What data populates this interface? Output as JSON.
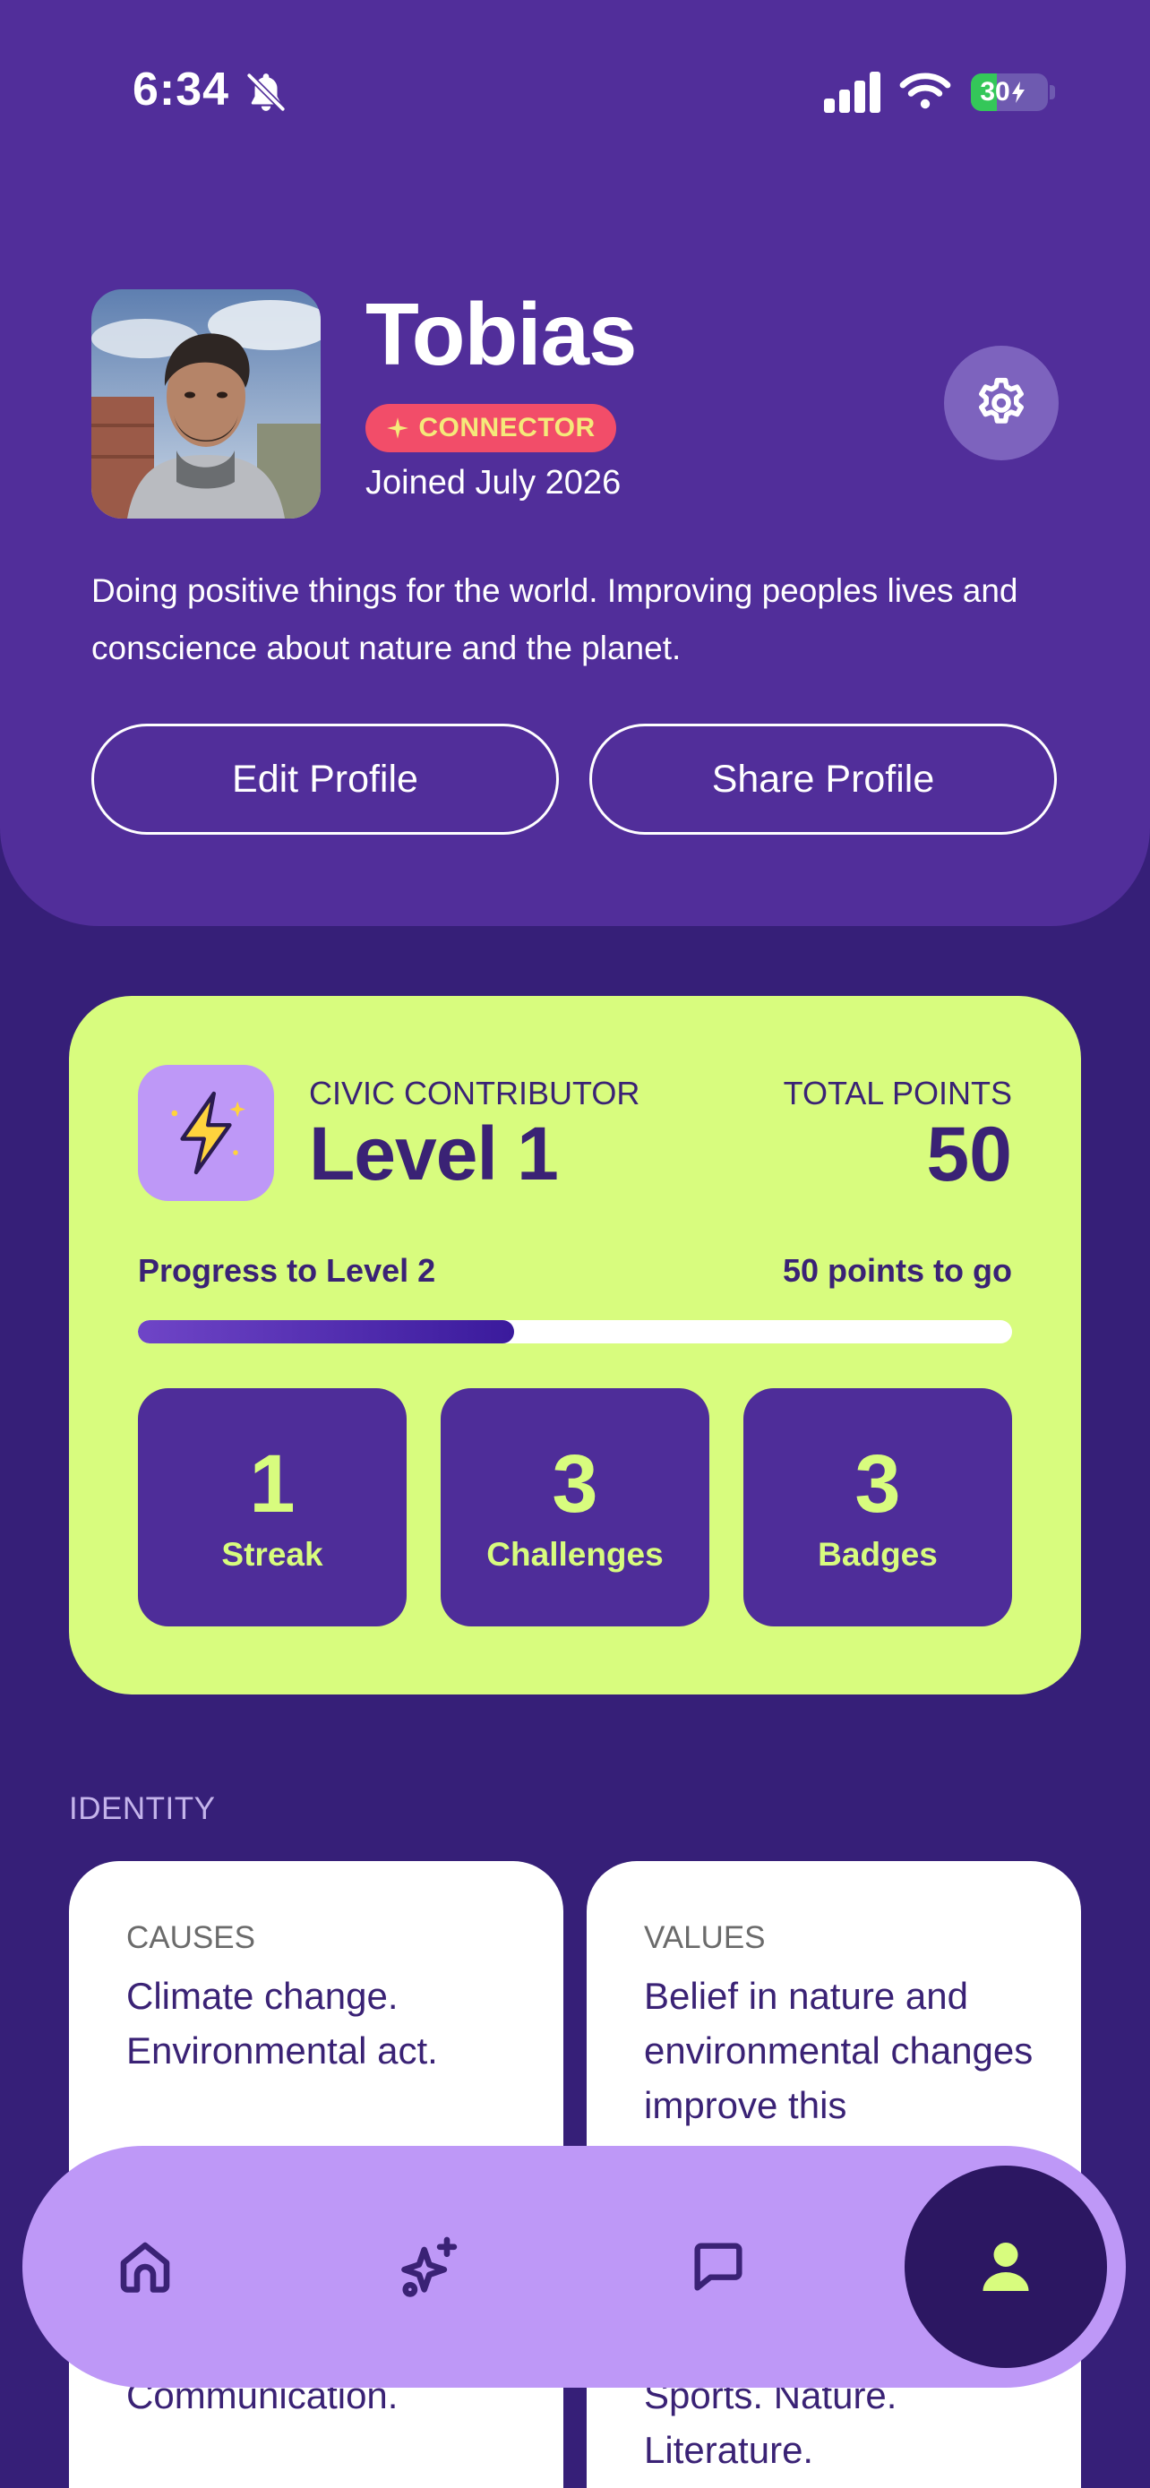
{
  "status_bar": {
    "time": "6:34",
    "battery_percent": "30"
  },
  "profile": {
    "name": "Tobias",
    "badge_label": "CONNECTOR",
    "joined": "Joined July 2026",
    "bio": "Doing positive things for the world. Improving peoples lives and conscience about nature and the planet.",
    "edit_label": "Edit Profile",
    "share_label": "Share Profile"
  },
  "level_card": {
    "rank_label": "CIVIC CONTRIBUTOR",
    "level_title": "Level 1",
    "points_label": "TOTAL POINTS",
    "points_value": "50",
    "progress_label": "Progress to Level 2",
    "progress_remaining": "50 points to go",
    "progress_fraction": 0.43,
    "stats": [
      {
        "value": "1",
        "label": "Streak"
      },
      {
        "value": "3",
        "label": "Challenges"
      },
      {
        "value": "3",
        "label": "Badges"
      }
    ]
  },
  "identity": {
    "heading": "IDENTITY",
    "causes": {
      "label": "CAUSES",
      "text": "Climate change. Environmental act.",
      "bottom_text": "Communication."
    },
    "values": {
      "label": "VALUES",
      "text": "Belief in nature and environmental changes improve this",
      "bottom_text": "Sports. Nature. Literature."
    }
  },
  "nav": {
    "items": [
      "home-icon",
      "sparkle-icon",
      "chat-icon",
      "profile-icon"
    ],
    "active": "profile-icon"
  },
  "colors": {
    "header_bg": "#512E9A",
    "page_bg": "#361F78",
    "lime": "#D8FC7E",
    "lavender": "#BE98F7",
    "badge": "#F24D69",
    "text_dark": "#3A2275"
  }
}
